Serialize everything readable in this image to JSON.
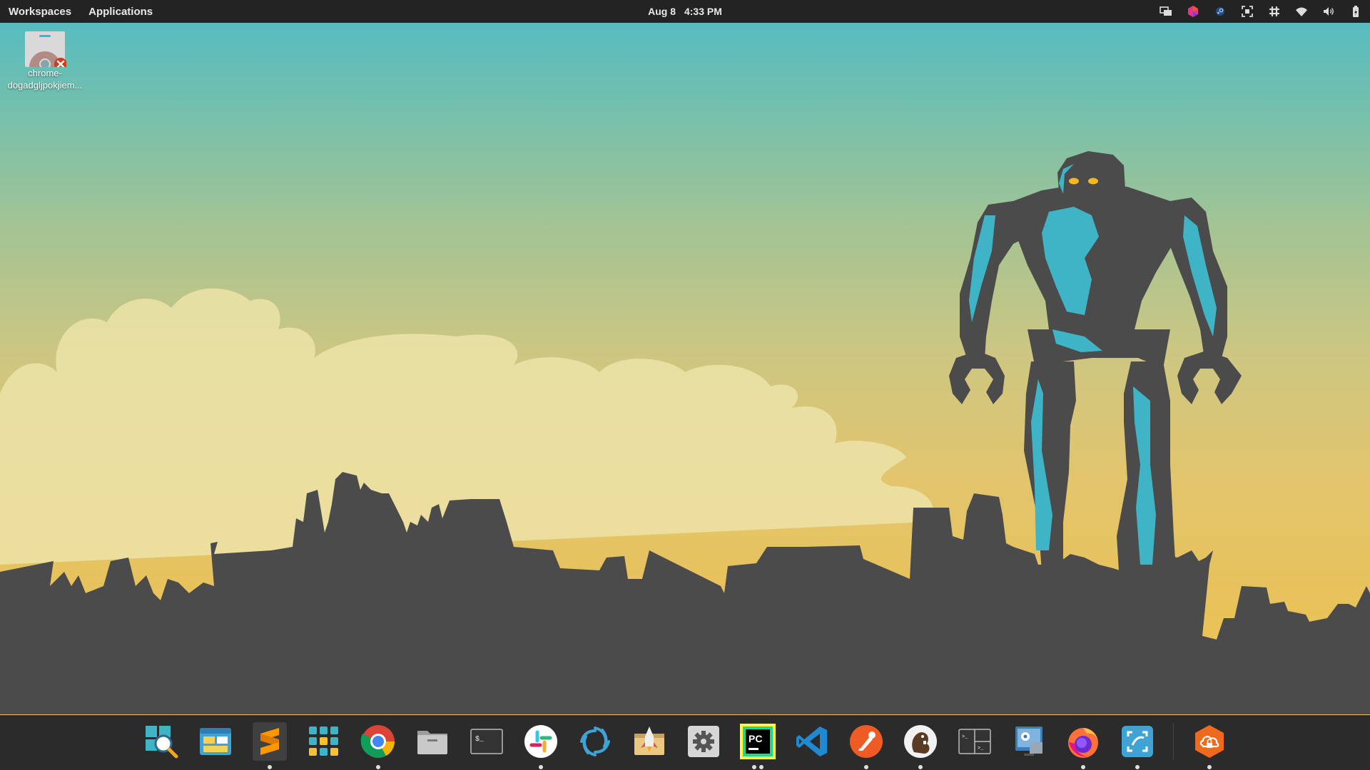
{
  "topbar": {
    "workspaces": "Workspaces",
    "applications": "Applications",
    "date": "Aug 8",
    "time": "4:33 PM"
  },
  "desktop_icon": {
    "label_line1": "chrome-",
    "label_line2": "dogadgljpokjiem..."
  },
  "tray": [
    "screens-icon",
    "colorful-app-icon",
    "steam-icon",
    "screenshot-icon",
    "slack-tray-icon",
    "wifi-icon",
    "volume-icon",
    "battery-icon"
  ],
  "dock": {
    "items": [
      {
        "name": "search-app",
        "running": 0
      },
      {
        "name": "window-manager",
        "running": 0
      },
      {
        "name": "sublime-text",
        "running": 1,
        "active": true
      },
      {
        "name": "app-grid",
        "running": 0
      },
      {
        "name": "chrome",
        "running": 1
      },
      {
        "name": "files",
        "running": 0
      },
      {
        "name": "terminal",
        "running": 0
      },
      {
        "name": "slack",
        "running": 1
      },
      {
        "name": "aperture",
        "running": 0
      },
      {
        "name": "launcher",
        "running": 0
      },
      {
        "name": "settings",
        "running": 0
      },
      {
        "name": "pycharm",
        "running": 2
      },
      {
        "name": "vscode",
        "running": 0
      },
      {
        "name": "postman",
        "running": 1
      },
      {
        "name": "dbeaver",
        "running": 1
      },
      {
        "name": "tilix",
        "running": 0
      },
      {
        "name": "virtualbox",
        "running": 0
      },
      {
        "name": "firefox",
        "running": 1
      },
      {
        "name": "screenshot-tool",
        "running": 1
      },
      {
        "name": "vpn",
        "running": 1
      }
    ]
  },
  "colors": {
    "sky_top": "#4fbac4",
    "sky_bottom": "#f0c14e",
    "silhouette": "#4b4b4b",
    "robot_accent": "#3fb4c6",
    "robot_eyes": "#f5b91e",
    "panel": "#232323",
    "dock": "#2b2b2b"
  }
}
